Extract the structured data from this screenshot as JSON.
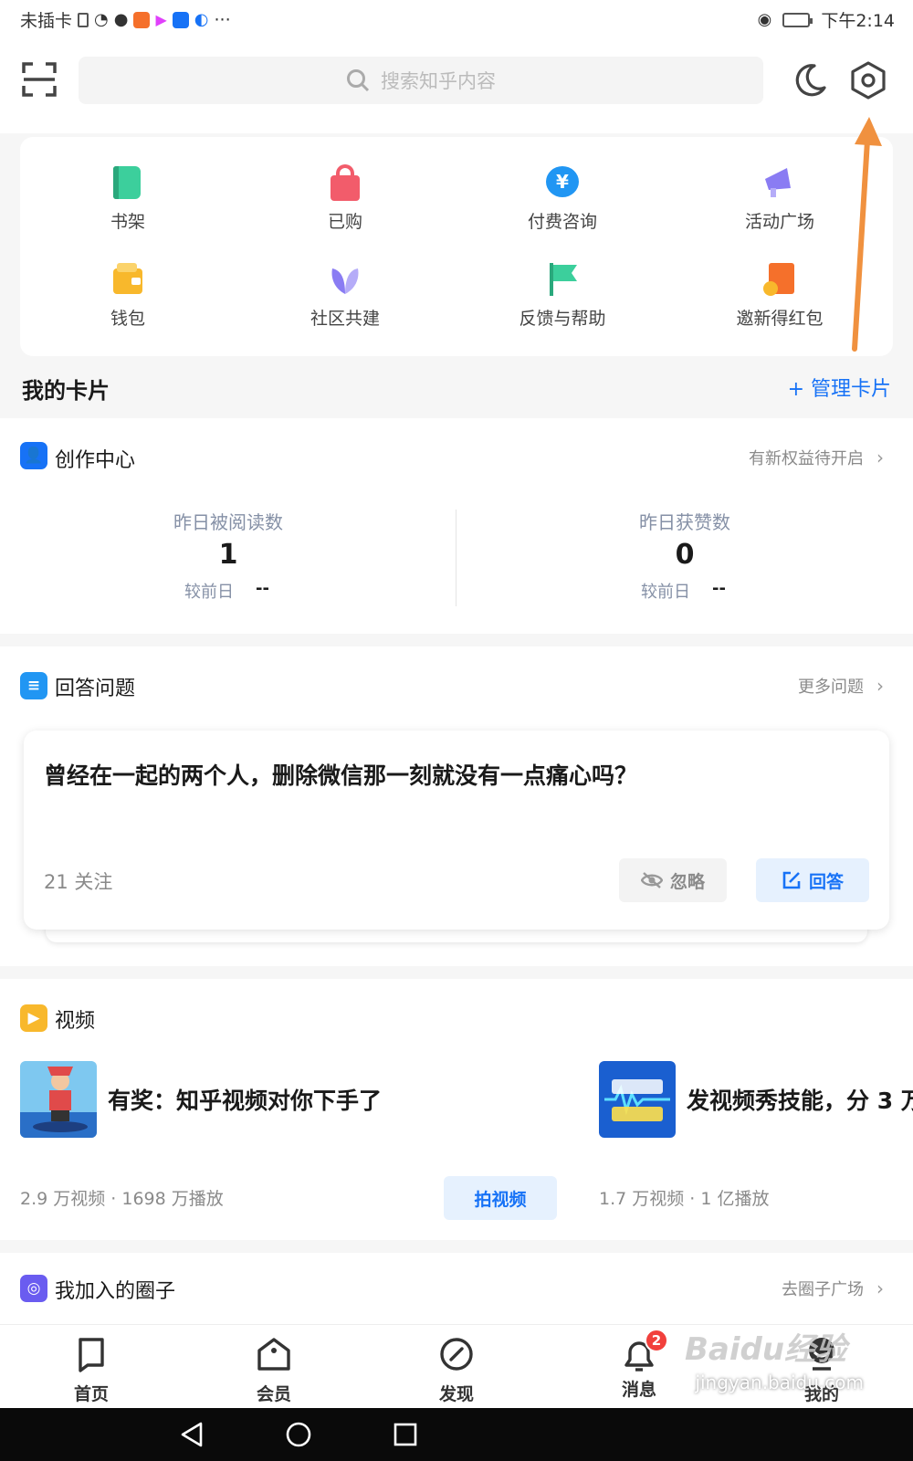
{
  "status_bar": {
    "carrier": "未插卡",
    "time": "下午2:14"
  },
  "header": {
    "search_placeholder": "搜索知乎内容"
  },
  "quick_grid": [
    {
      "label": "书架",
      "icon": "book-icon",
      "color": "#3ccf9c"
    },
    {
      "label": "已购",
      "icon": "shopping-bag-icon",
      "color": "#f25c6b"
    },
    {
      "label": "付费咨询",
      "icon": "yuan-chat-icon",
      "color": "#2196f3"
    },
    {
      "label": "活动广场",
      "icon": "megaphone-icon",
      "color": "#8a7cf3"
    },
    {
      "label": "钱包",
      "icon": "wallet-icon",
      "color": "#f8b82c"
    },
    {
      "label": "社区共建",
      "icon": "sprout-icon",
      "color": "#8a7cf3"
    },
    {
      "label": "反馈与帮助",
      "icon": "flag-icon",
      "color": "#3ccf9c"
    },
    {
      "label": "邀新得红包",
      "icon": "red-envelope-icon",
      "color": "#f5702b"
    }
  ],
  "my_cards": {
    "title": "我的卡片",
    "manage": "+ 管理卡片"
  },
  "creation_center": {
    "title": "创作中心",
    "link": "有新权益待开启",
    "stats": [
      {
        "label": "昨日被阅读数",
        "value": "1",
        "compare_label": "较前日",
        "compare_value": "--"
      },
      {
        "label": "昨日获赞数",
        "value": "0",
        "compare_label": "较前日",
        "compare_value": "--"
      }
    ]
  },
  "answer_questions": {
    "title": "回答问题",
    "link": "更多问题",
    "question": "曾经在一起的两个人，删除微信那一刻就没有一点痛心吗？",
    "followers": "21 关注",
    "ignore": "忽略",
    "answer": "回答"
  },
  "video": {
    "title": "视频",
    "items": [
      {
        "title": "有奖：知乎视频对你下手了",
        "meta": "2.9 万视频 · 1698 万播放"
      },
      {
        "title": "发视频秀技能，分 3 万",
        "meta": "1.7 万视频 · 1 亿播放"
      }
    ],
    "shoot_button": "拍视频"
  },
  "circles": {
    "title": "我加入的圈子",
    "link": "去圈子广场"
  },
  "bottom_nav": [
    {
      "label": "首页",
      "icon": "home-icon"
    },
    {
      "label": "会员",
      "icon": "crown-icon"
    },
    {
      "label": "发现",
      "icon": "compass-icon"
    },
    {
      "label": "消息",
      "icon": "bell-icon",
      "badge": "2"
    },
    {
      "label": "我的",
      "icon": "profile-icon"
    }
  ],
  "watermark": {
    "logo": "Baidu经验",
    "url": "jingyan.baidu.com"
  },
  "colors": {
    "accent": "#1772f6",
    "arrow": "#f0913f",
    "badge": "#f1403c"
  }
}
